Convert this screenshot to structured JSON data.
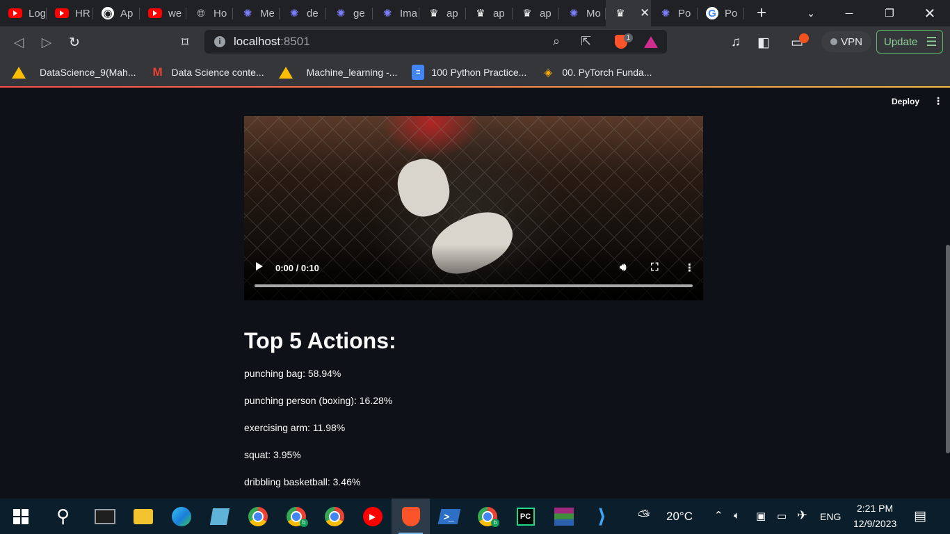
{
  "browser": {
    "tabs": [
      {
        "icon": "youtube-icon",
        "title": "Log"
      },
      {
        "icon": "youtube-icon",
        "title": "HR"
      },
      {
        "icon": "github-icon",
        "title": "Ap"
      },
      {
        "icon": "youtube-icon",
        "title": "we"
      },
      {
        "icon": "globe-icon",
        "title": "Ho"
      },
      {
        "icon": "gear-icon",
        "title": "Me"
      },
      {
        "icon": "gear-icon",
        "title": "de"
      },
      {
        "icon": "gear-icon",
        "title": "ge"
      },
      {
        "icon": "gear-icon",
        "title": "Ima"
      },
      {
        "icon": "streamlit-crown-icon",
        "title": "ap"
      },
      {
        "icon": "streamlit-crown-icon",
        "title": "ap"
      },
      {
        "icon": "streamlit-crown-icon",
        "title": "ap"
      },
      {
        "icon": "gear-icon",
        "title": "Mo"
      },
      {
        "icon": "streamlit-crown-icon",
        "title": "",
        "active": true
      },
      {
        "icon": "gear-icon",
        "title": "Po"
      },
      {
        "icon": "google-icon",
        "title": "Po"
      }
    ],
    "url_host": "localhost",
    "url_port": ":8501",
    "brave_badge": "1",
    "vpn_label": "VPN",
    "update_label": "Update",
    "bookmarks": [
      {
        "icon": "google-drive-icon",
        "label": "DataScience_9(Mah..."
      },
      {
        "icon": "gmail-icon",
        "label": "Data Science conte..."
      },
      {
        "icon": "google-drive-icon",
        "label": "Machine_learning -..."
      },
      {
        "icon": "google-docs-icon",
        "label": "100 Python Practice..."
      },
      {
        "icon": "colab-icon",
        "label": "00. PyTorch Funda..."
      }
    ]
  },
  "app": {
    "deploy_label": "Deploy",
    "video": {
      "time": "0:00 / 0:10",
      "progress": 0
    },
    "heading": "Top 5 Actions:",
    "actions": [
      "punching bag: 58.94%",
      "punching person (boxing): 16.28%",
      "exercising arm: 11.98%",
      "squat: 3.95%",
      "dribbling basketball: 3.46%"
    ]
  },
  "taskbar": {
    "apps": [
      "start-icon",
      "search-icon",
      "terminal-icon",
      "file-explorer-icon",
      "edge-icon",
      "notepad-icon",
      "chrome-icon",
      "chrome-profile-icon",
      "chrome-profile-icon",
      "youtube-music-icon",
      "brave-icon",
      "powershell-icon",
      "chrome-profile-icon",
      "pycharm-icon",
      "winrar-icon",
      "vscode-icon"
    ],
    "weather": "20°C",
    "language": "ENG",
    "time": "2:21 PM",
    "date": "12/9/2023"
  }
}
